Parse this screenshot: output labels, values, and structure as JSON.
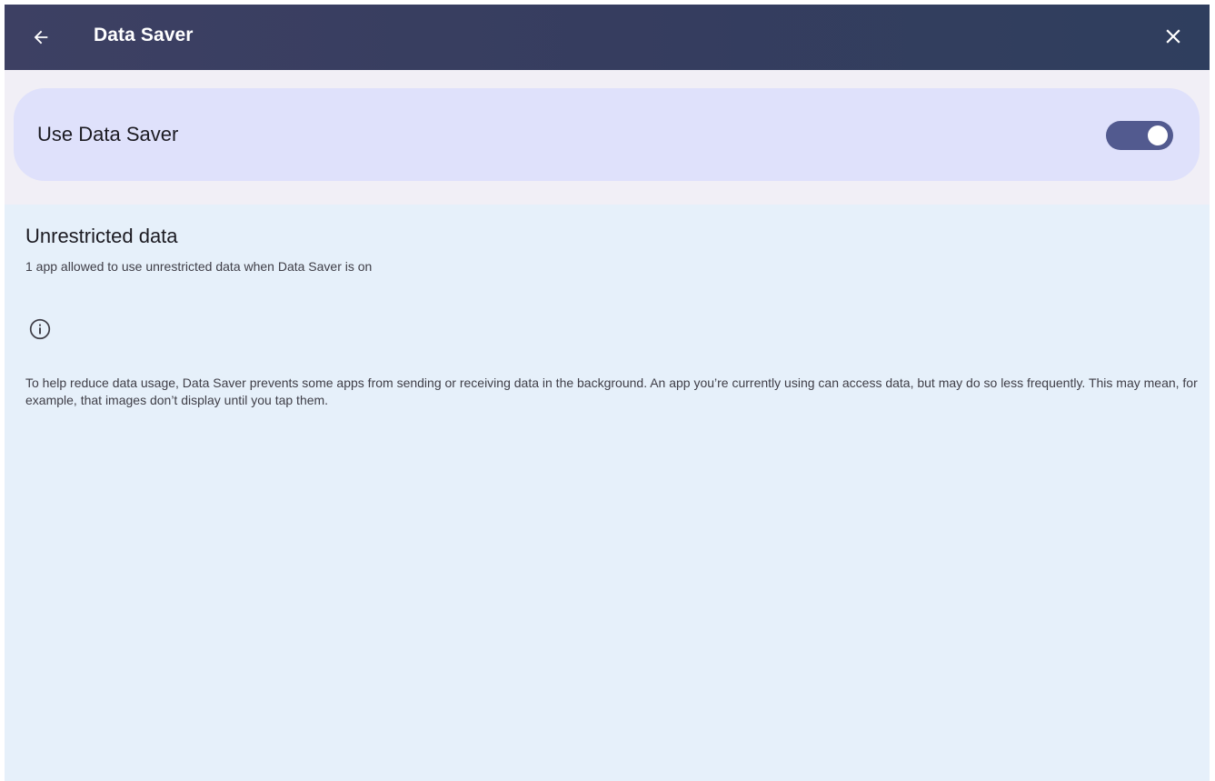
{
  "appbar": {
    "title": "Data Saver",
    "back_icon": "arrow-back-icon",
    "close_icon": "close-icon"
  },
  "toggle": {
    "label": "Use Data Saver",
    "state": "on"
  },
  "unrestricted": {
    "title": "Unrestricted data",
    "subtitle": "1 app allowed to use unrestricted data when Data Saver is on"
  },
  "info": {
    "icon": "info-icon",
    "text": "To help reduce data usage, Data Saver prevents some apps from sending or receiving data in the background. An app you’re currently using can access data, but may do so less frequently. This may mean, for example, that images don’t display until you tap them."
  },
  "colors": {
    "appbar": "#363d5f",
    "card": "#dfe1fb",
    "switch_track": "#525a8f",
    "page_background": "#e6f0fa"
  }
}
